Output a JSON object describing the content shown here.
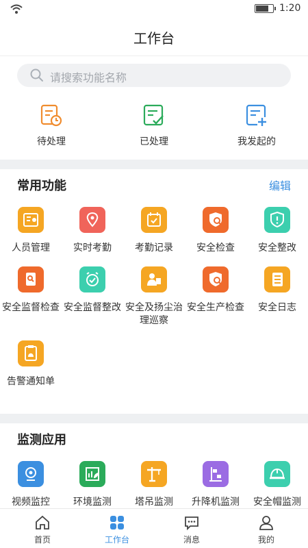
{
  "status_bar": {
    "time": "1:20",
    "battery_level": 0.75
  },
  "header": {
    "title": "工作台"
  },
  "search": {
    "placeholder": "请搜索功能名称"
  },
  "quick_actions": [
    {
      "label": "待处理",
      "icon": "pending-doc-clock-icon",
      "color": "#f08c2e"
    },
    {
      "label": "已处理",
      "icon": "done-doc-check-icon",
      "color": "#2bab5a"
    },
    {
      "label": "我发起的",
      "icon": "initiated-doc-plus-icon",
      "color": "#3b8fe0"
    }
  ],
  "common": {
    "title": "常用功能",
    "edit": "编辑",
    "items": [
      {
        "label": "人员管理",
        "icon": "personnel-card-icon",
        "color": "#f5a623"
      },
      {
        "label": "实时考勤",
        "icon": "location-pin-icon",
        "color": "#f0645a"
      },
      {
        "label": "考勤记录",
        "icon": "calendar-check-icon",
        "color": "#f5a623"
      },
      {
        "label": "安全检查",
        "icon": "shield-search-icon",
        "color": "#ef6a2c"
      },
      {
        "label": "安全整改",
        "icon": "shield-alert-icon",
        "color": "#3ccfae"
      },
      {
        "label": "安全监督检查",
        "icon": "doc-search-icon",
        "color": "#ef6a2c"
      },
      {
        "label": "安全监督整改",
        "icon": "alarm-check-icon",
        "color": "#3ccfae"
      },
      {
        "label": "安全及扬尘治理巡察",
        "icon": "inspector-icon",
        "color": "#f5a623"
      },
      {
        "label": "安全生产检查",
        "icon": "shield-search-icon",
        "color": "#ef6a2c"
      },
      {
        "label": "安全日志",
        "icon": "log-book-icon",
        "color": "#f5a623"
      },
      {
        "label": "告警通知单",
        "icon": "alarm-clipboard-icon",
        "color": "#f5a623"
      }
    ]
  },
  "monitoring": {
    "title": "监测应用",
    "items": [
      {
        "label": "视频监控",
        "icon": "webcam-icon",
        "color": "#3b8fe0"
      },
      {
        "label": "环境监测",
        "icon": "environment-chart-icon",
        "color": "#2bab5a"
      },
      {
        "label": "塔吊监测",
        "icon": "tower-crane-icon",
        "color": "#f5a623"
      },
      {
        "label": "升降机监测",
        "icon": "elevator-icon",
        "color": "#9b6ce3"
      },
      {
        "label": "安全帽监测",
        "icon": "helmet-icon",
        "color": "#3ccfae"
      }
    ]
  },
  "tabbar": {
    "items": [
      {
        "label": "首页",
        "icon": "home-icon"
      },
      {
        "label": "工作台",
        "icon": "grid-icon",
        "active": true
      },
      {
        "label": "消息",
        "icon": "message-icon"
      },
      {
        "label": "我的",
        "icon": "user-icon"
      }
    ],
    "active_color": "#3b8fe0"
  }
}
